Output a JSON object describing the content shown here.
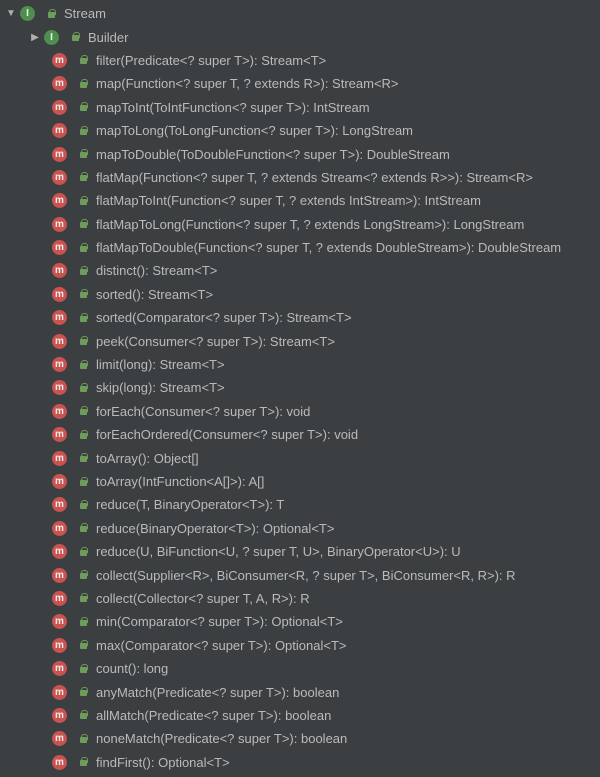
{
  "root": {
    "label": "Stream",
    "icon": "interface",
    "expanded": true
  },
  "builder": {
    "label": "Builder",
    "icon": "interface",
    "expanded": false
  },
  "methods": [
    {
      "sig": "filter(Predicate<? super T>): Stream<T>"
    },
    {
      "sig": "map(Function<? super T, ? extends R>): Stream<R>"
    },
    {
      "sig": "mapToInt(ToIntFunction<? super T>): IntStream"
    },
    {
      "sig": "mapToLong(ToLongFunction<? super T>): LongStream"
    },
    {
      "sig": "mapToDouble(ToDoubleFunction<? super T>): DoubleStream"
    },
    {
      "sig": "flatMap(Function<? super T, ? extends Stream<? extends R>>): Stream<R>"
    },
    {
      "sig": "flatMapToInt(Function<? super T, ? extends IntStream>): IntStream"
    },
    {
      "sig": "flatMapToLong(Function<? super T, ? extends LongStream>): LongStream"
    },
    {
      "sig": "flatMapToDouble(Function<? super T, ? extends DoubleStream>): DoubleStream"
    },
    {
      "sig": "distinct(): Stream<T>"
    },
    {
      "sig": "sorted(): Stream<T>"
    },
    {
      "sig": "sorted(Comparator<? super T>): Stream<T>"
    },
    {
      "sig": "peek(Consumer<? super T>): Stream<T>"
    },
    {
      "sig": "limit(long): Stream<T>"
    },
    {
      "sig": "skip(long): Stream<T>"
    },
    {
      "sig": "forEach(Consumer<? super T>): void"
    },
    {
      "sig": "forEachOrdered(Consumer<? super T>): void"
    },
    {
      "sig": "toArray(): Object[]"
    },
    {
      "sig": "toArray(IntFunction<A[]>): A[]"
    },
    {
      "sig": "reduce(T, BinaryOperator<T>): T"
    },
    {
      "sig": "reduce(BinaryOperator<T>): Optional<T>"
    },
    {
      "sig": "reduce(U, BiFunction<U, ? super T, U>, BinaryOperator<U>): U"
    },
    {
      "sig": "collect(Supplier<R>, BiConsumer<R, ? super T>, BiConsumer<R, R>): R"
    },
    {
      "sig": "collect(Collector<? super T, A, R>): R"
    },
    {
      "sig": "min(Comparator<? super T>): Optional<T>"
    },
    {
      "sig": "max(Comparator<? super T>): Optional<T>"
    },
    {
      "sig": "count(): long"
    },
    {
      "sig": "anyMatch(Predicate<? super T>): boolean"
    },
    {
      "sig": "allMatch(Predicate<? super T>): boolean"
    },
    {
      "sig": "noneMatch(Predicate<? super T>): boolean"
    },
    {
      "sig": "findFirst(): Optional<T>"
    }
  ]
}
